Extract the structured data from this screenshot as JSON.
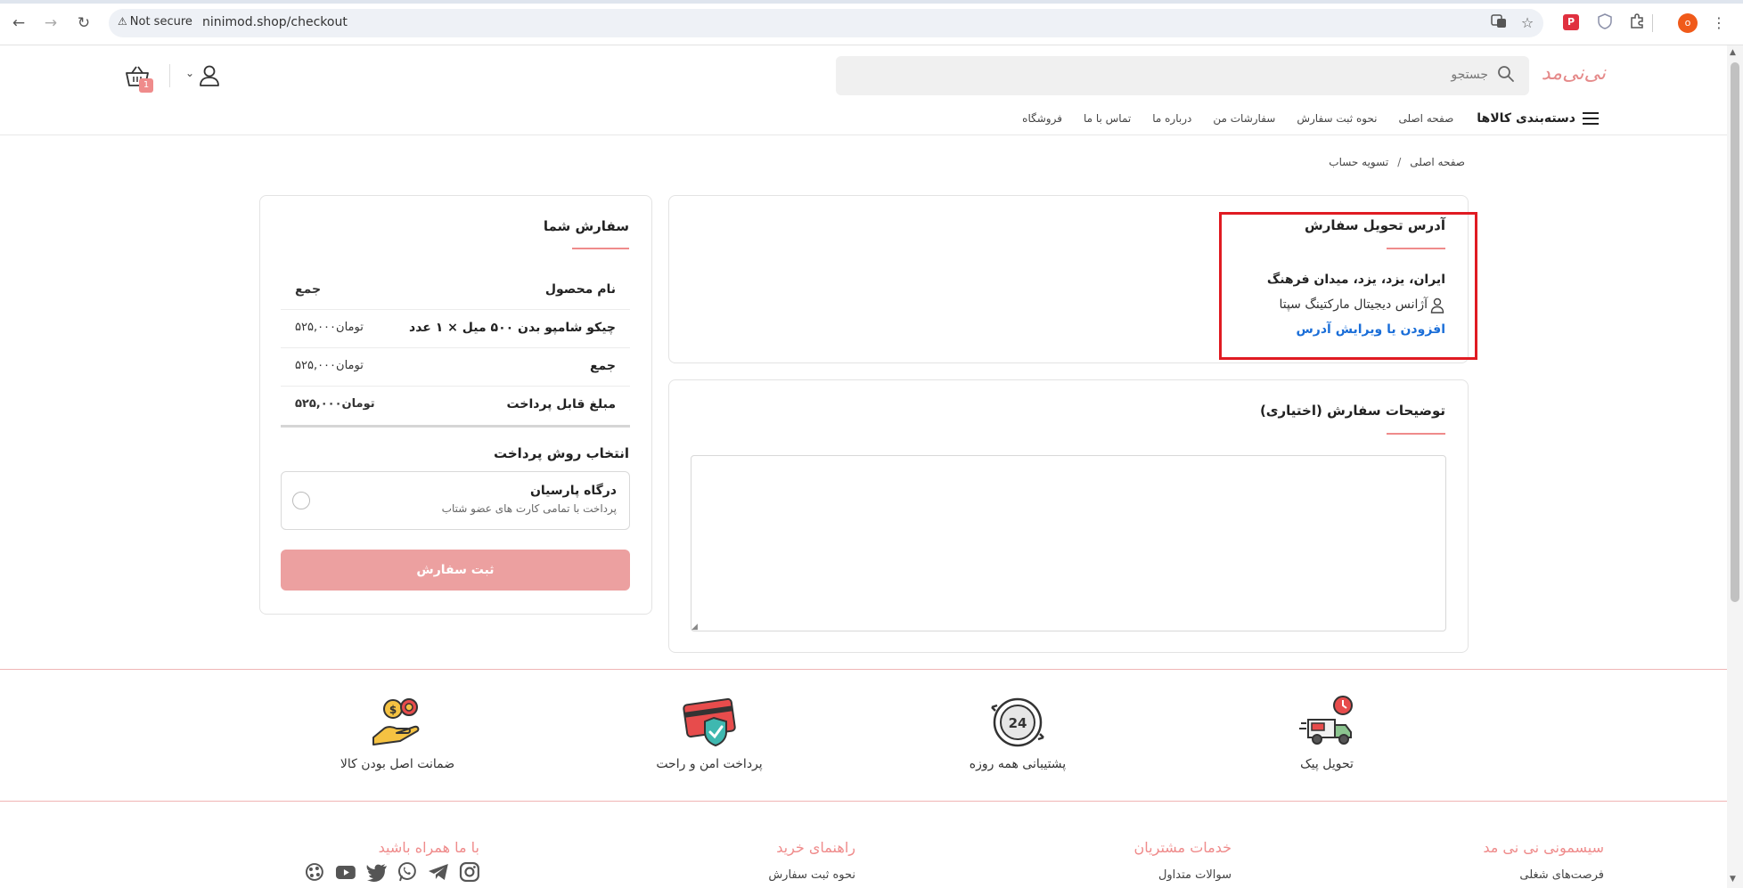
{
  "browser": {
    "security_label": "Not secure",
    "url": "ninimod.shop/checkout",
    "profile_initial": "o"
  },
  "header": {
    "logo_text": "نی‌نی‌مد",
    "search_placeholder": "جستجو",
    "cart_count": "1"
  },
  "nav": {
    "categories_label": "دسته‌بندی کالاها",
    "links": [
      "صفحه اصلی",
      "نحوه ثبت سفارش",
      "سفارشات من",
      "درباره ما",
      "تماس با ما",
      "فروشگاه"
    ]
  },
  "breadcrumb": {
    "home": "صفحه اصلی",
    "separator": "/",
    "current": "تسویه حساب"
  },
  "address": {
    "title": "آدرس تحویل سفارش",
    "line": "ایران، یزد، یزد، میدان فرهنگ",
    "recipient": "آژانس دیجیتال مارکتینگ سپتا",
    "edit_link": "افزودن یا ویرایش آدرس"
  },
  "notes": {
    "title": "توضیحات سفارش (اختیاری)",
    "value": ""
  },
  "order": {
    "title": "سفارش شما",
    "header_product": "نام محصول",
    "header_total": "جمع",
    "rows": [
      {
        "name": "چیکو شامپو بدن ۵۰۰ میل × ۱ عدد",
        "amount": "۵۲۵,۰۰۰",
        "currency": "تومان"
      },
      {
        "name": "جمع",
        "amount": "۵۲۵,۰۰۰",
        "currency": "تومان"
      },
      {
        "name": "مبلغ قابل پرداخت",
        "amount": "۵۲۵,۰۰۰",
        "currency": "تومان"
      }
    ],
    "payment_title": "انتخاب روش پرداخت",
    "payment_name": "درگاه پارسیان",
    "payment_desc": "پرداخت با تمامی کارت های عضو شتاب",
    "submit_label": "ثبت سفارش"
  },
  "features": [
    {
      "label": "تحویل پیک",
      "icon": "delivery-truck-icon"
    },
    {
      "label": "پشتیبانی همه روزه",
      "icon": "support-24-icon"
    },
    {
      "label": "پرداخت امن و راحت",
      "icon": "secure-card-icon"
    },
    {
      "label": "ضمانت اصل بودن کالا",
      "icon": "guarantee-coin-icon"
    }
  ],
  "footer": {
    "col1_title": "سیسمونی نی نی مد",
    "col1_link": "فرصت‌های شغلی",
    "col2_title": "خدمات مشتریان",
    "col2_link": "سوالات متداول",
    "col3_title": "راهنمای خرید",
    "col3_link": "نحوه ثبت سفارش",
    "col4_title": "با ما همراه باشید",
    "socials": [
      "instagram-icon",
      "telegram-icon",
      "whatsapp-icon",
      "twitter-icon",
      "youtube-icon",
      "aparat-icon"
    ]
  },
  "colors": {
    "accent": "#ef8b8b",
    "highlight": "#e01b22",
    "link": "#1a6ed8"
  }
}
